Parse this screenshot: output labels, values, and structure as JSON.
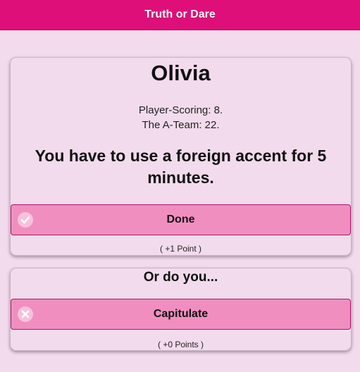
{
  "header": {
    "title": "Truth or Dare",
    "color": "#df0f7a"
  },
  "challenge": {
    "player_name": "Olivia",
    "scores": [
      "Player-Scoring: 8.",
      "The A-Team: 22."
    ],
    "dare": "You have to use a foreign accent for 5 minutes.",
    "done_button": {
      "label": "Done",
      "icon": "check-icon"
    },
    "done_points": "( +1 Point )"
  },
  "alternative": {
    "heading": "Or do you...",
    "capitulate_button": {
      "label": "Capitulate",
      "icon": "close-icon"
    },
    "capitulate_points": "( +0 Points )"
  },
  "colors": {
    "background": "#f2dbec",
    "button": "#f08fbf",
    "button_border": "#b0136a"
  }
}
